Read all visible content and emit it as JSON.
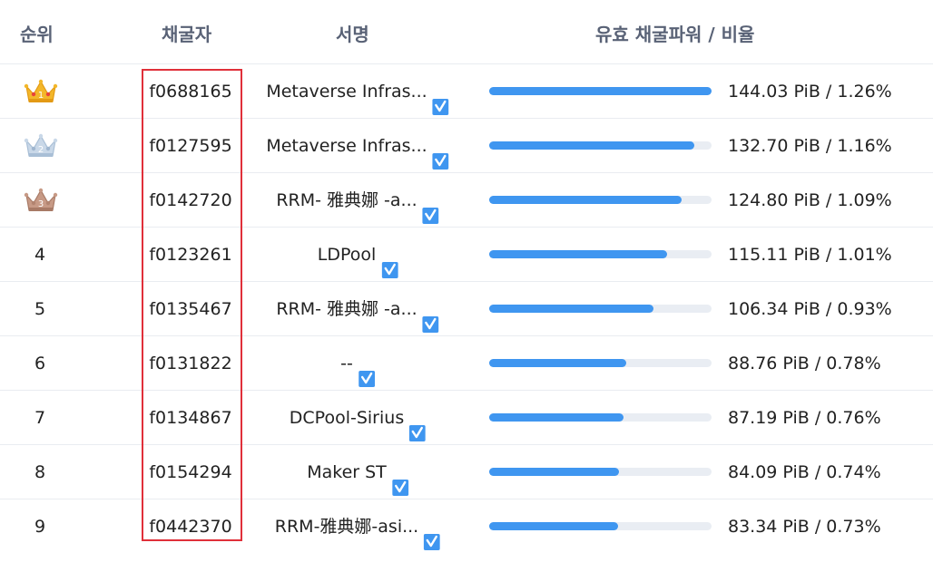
{
  "headers": {
    "rank": "순위",
    "miner": "채굴자",
    "signature": "서명",
    "power": "유효 채굴파워 / 비율"
  },
  "colors": {
    "bar_fill": "#3f96f0",
    "bar_track": "#e9edf3",
    "highlight_box": "#e0303a",
    "verified_badge": "#3f96f0",
    "gold": "#f3b72a",
    "silver": "#c9d8e8",
    "bronze": "#c79a86"
  },
  "rows": [
    {
      "rank": "1",
      "rank_icon": "gold-crown-icon",
      "crown_label": "1",
      "miner": "f0688165",
      "signature": "Metaverse Infras...",
      "verified": true,
      "power": "144.03 PiB / 1.26%",
      "bar_fraction": 1.0
    },
    {
      "rank": "2",
      "rank_icon": "silver-crown-icon",
      "crown_label": "2",
      "miner": "f0127595",
      "signature": "Metaverse Infras...",
      "verified": true,
      "power": "132.70 PiB / 1.16%",
      "bar_fraction": 0.921
    },
    {
      "rank": "3",
      "rank_icon": "bronze-crown-icon",
      "crown_label": "3",
      "miner": "f0142720",
      "signature": "RRM- 雅典娜 -a...",
      "verified": true,
      "power": "124.80 PiB / 1.09%",
      "bar_fraction": 0.866
    },
    {
      "rank": "4",
      "miner": "f0123261",
      "signature": "LDPool",
      "verified": true,
      "power": "115.11 PiB / 1.01%",
      "bar_fraction": 0.799
    },
    {
      "rank": "5",
      "miner": "f0135467",
      "signature": "RRM- 雅典娜 -a...",
      "verified": true,
      "power": "106.34 PiB / 0.93%",
      "bar_fraction": 0.738
    },
    {
      "rank": "6",
      "miner": "f0131822",
      "signature": "--",
      "verified": true,
      "power": "88.76 PiB / 0.78%",
      "bar_fraction": 0.616
    },
    {
      "rank": "7",
      "miner": "f0134867",
      "signature": "DCPool-Sirius",
      "verified": true,
      "power": "87.19 PiB / 0.76%",
      "bar_fraction": 0.605
    },
    {
      "rank": "8",
      "miner": "f0154294",
      "signature": "Maker ST",
      "verified": true,
      "power": "84.09 PiB / 0.74%",
      "bar_fraction": 0.584
    },
    {
      "rank": "9",
      "miner": "f0442370",
      "signature": "RRM-雅典娜-asi...",
      "verified": true,
      "power": "83.34 PiB / 0.73%",
      "bar_fraction": 0.579
    }
  ]
}
